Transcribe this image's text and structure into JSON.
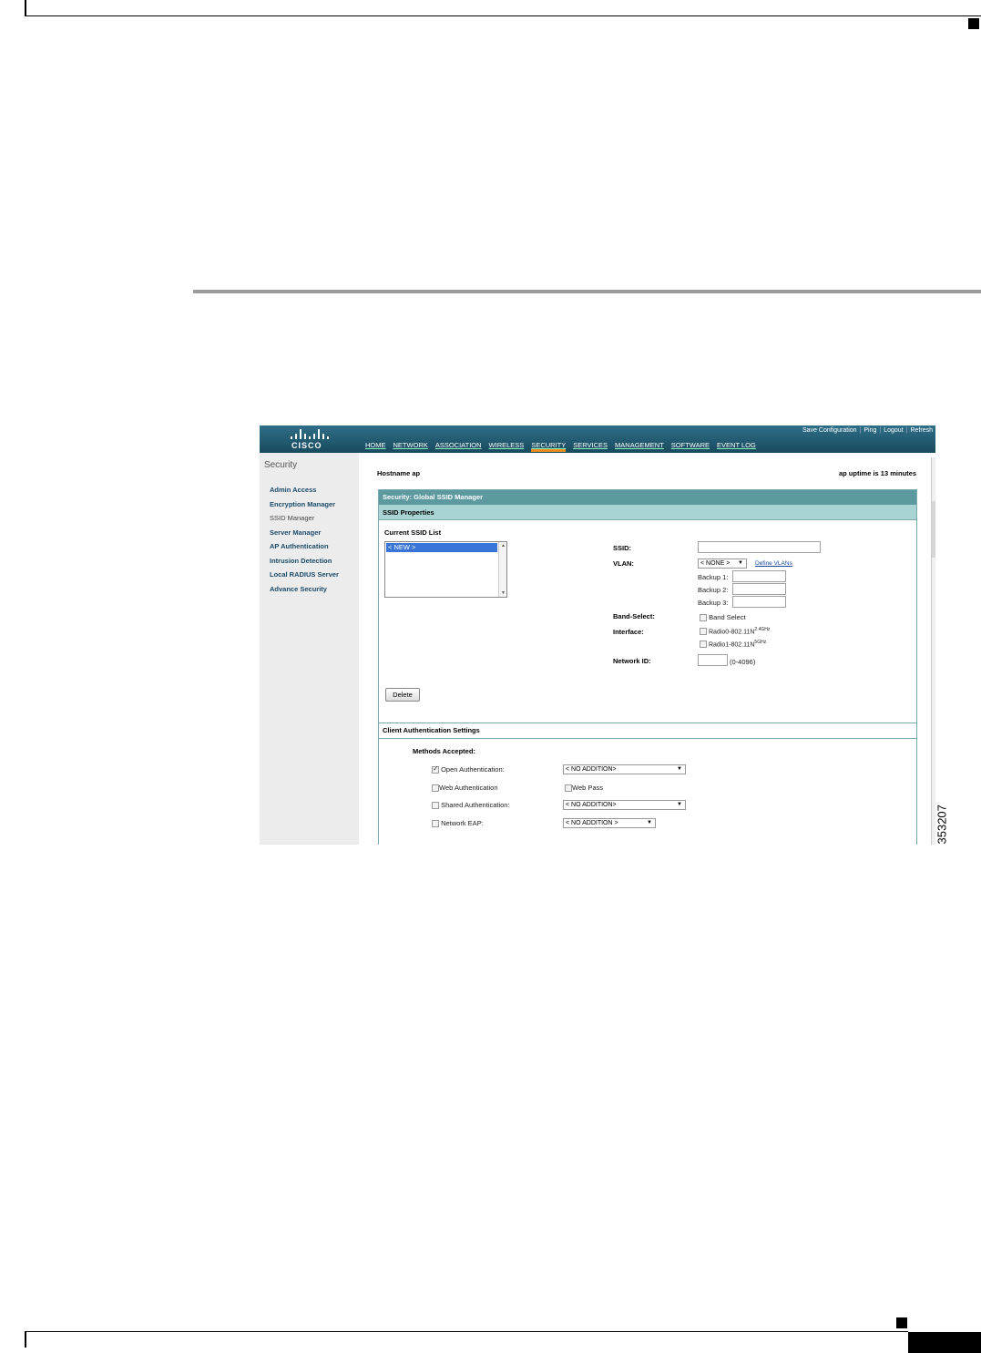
{
  "figure_id": "353207",
  "header": {
    "logo_text": "CISCO",
    "top_links": [
      "Save Configuration",
      "Ping",
      "Logout",
      "Refresh"
    ],
    "nav": [
      "HOME",
      "NETWORK",
      "ASSOCIATION",
      "WIRELESS",
      "SECURITY",
      "SERVICES",
      "MANAGEMENT",
      "SOFTWARE",
      "EVENT LOG"
    ],
    "active_nav": "SECURITY",
    "active_color": "#e98a1e"
  },
  "sidebar": {
    "title": "Security",
    "items": [
      "Admin Access",
      "Encryption Manager",
      "SSID Manager",
      "Server Manager",
      "AP Authentication",
      "Intrusion Detection",
      "Local RADIUS Server",
      "Advance Security"
    ],
    "current": "SSID Manager"
  },
  "status": {
    "hostname": "Hostname  ap",
    "uptime": "ap uptime is 13 minutes"
  },
  "panel": {
    "title": "Security: Global SSID Manager",
    "subtitle": "SSID Properties",
    "current_ssid_list_label": "Current SSID List",
    "ssid_list": [
      "< NEW >"
    ],
    "ssid_label": "SSID:",
    "ssid_value": "",
    "vlan_label": "VLAN:",
    "vlan_value": "< NONE >",
    "define_vlans": "Define VLANs",
    "backup1": "Backup 1:",
    "backup2": "Backup 2:",
    "backup3": "Backup 3:",
    "band_select_label": "Band-Select:",
    "band_select_option": "Band Select",
    "interface_label": "Interface:",
    "radio0": "Radio0-802.11N",
    "radio0_sup": "2.4GHz",
    "radio1": "Radio1-802.11N",
    "radio1_sup": "5GHz",
    "network_id_label": "Network ID:",
    "network_id_range": "(0-4096)",
    "delete_button": "Delete",
    "client_auth_title": "Client Authentication Settings",
    "methods_label": "Methods Accepted:",
    "open_auth": "Open Authentication:",
    "open_auth_value": "< NO ADDITION>",
    "web_auth": "Web Authentication",
    "web_pass": "Web Pass",
    "shared_auth": "Shared Authentication:",
    "shared_auth_value": "< NO ADDITION>",
    "network_eap": "Network EAP:",
    "network_eap_value": "< NO ADDITION >"
  }
}
